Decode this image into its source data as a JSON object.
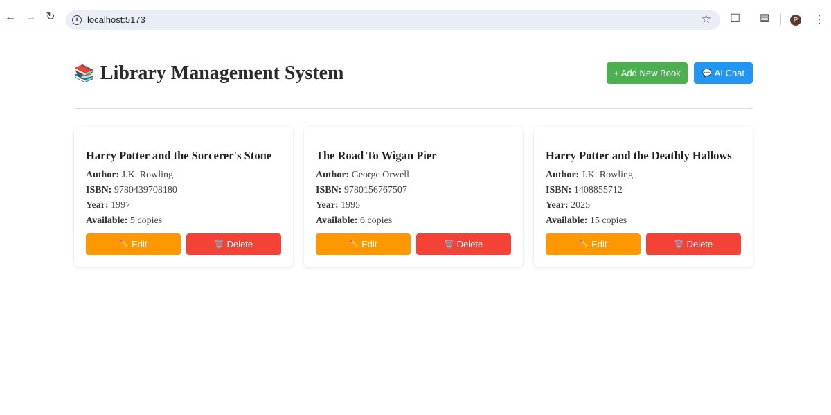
{
  "browser": {
    "url": "localhost:5173",
    "profile_initial": "P"
  },
  "header": {
    "title_emoji": "📚",
    "title": "Library Management System",
    "add_button_label": "+ Add New Book",
    "chat_button_icon": "💬",
    "chat_button_label": "AI Chat"
  },
  "labels": {
    "author": "Author:",
    "isbn": "ISBN:",
    "year": "Year:",
    "available": "Available:",
    "edit_icon": "✏️",
    "edit": "Edit",
    "delete_icon": "🗑️",
    "delete": "Delete"
  },
  "books": [
    {
      "title": "Harry Potter and the Sorcerer's Stone",
      "author": "J.K. Rowling",
      "isbn": "9780439708180",
      "year": "1997",
      "available": "5 copies"
    },
    {
      "title": "The Road To Wigan Pier",
      "author": "George Orwell",
      "isbn": "9780156767507",
      "year": "1995",
      "available": "6 copies"
    },
    {
      "title": "Harry Potter and the Deathly Hallows",
      "author": "J.K. Rowling",
      "isbn": "1408855712",
      "year": "2025",
      "available": "15 copies"
    }
  ],
  "colors": {
    "add": "#4caf50",
    "chat": "#2196f3",
    "edit": "#ff9800",
    "delete": "#f44336"
  }
}
